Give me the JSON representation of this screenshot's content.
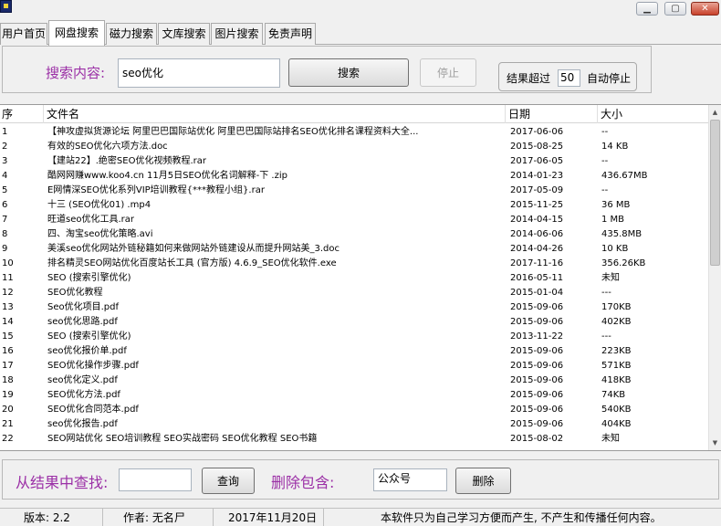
{
  "tabs": [
    {
      "label": "用户首页"
    },
    {
      "label": "网盘搜索"
    },
    {
      "label": "磁力搜索"
    },
    {
      "label": "文库搜索"
    },
    {
      "label": "图片搜索"
    },
    {
      "label": "免责声明"
    }
  ],
  "active_tab": "网盘搜索",
  "search": {
    "label": "搜索内容:",
    "value": "seo优化",
    "search_button": "搜索",
    "stop_button": "停止",
    "limit_prefix": "结果超过",
    "limit_value": "50",
    "limit_suffix": "自动停止"
  },
  "table": {
    "columns": [
      "序",
      "文件名",
      "日期",
      "大小"
    ],
    "rows": [
      {
        "no": "1",
        "name": "【神攻虚拟货源论坛 阿里巴巴国际站优化 阿里巴巴国际站排名SEO优化排名课程资料大全...",
        "date": "2017-06-06",
        "size": "--"
      },
      {
        "no": "2",
        "name": "有效的SEO优化六项方法.doc",
        "date": "2015-08-25",
        "size": "14 KB"
      },
      {
        "no": "3",
        "name": "【建站22】.绝密SEO优化视频教程.rar",
        "date": "2017-06-05",
        "size": "--"
      },
      {
        "no": "4",
        "name": "酷网网赚www.koo4.cn 11月5日SEO优化名词解释-下 .zip",
        "date": "2014-01-23",
        "size": "436.67MB"
      },
      {
        "no": "5",
        "name": "E网情深SEO优化系列VIP培训教程{***教程小组}.rar",
        "date": "2017-05-09",
        "size": "--"
      },
      {
        "no": "6",
        "name": "十三 (SEO优化01) .mp4",
        "date": "2015-11-25",
        "size": "36 MB"
      },
      {
        "no": "7",
        "name": "旺道seo优化工具.rar",
        "date": "2014-04-15",
        "size": "1 MB"
      },
      {
        "no": "8",
        "name": "四、淘宝seo优化策略.avi",
        "date": "2014-06-06",
        "size": "435.8MB"
      },
      {
        "no": "9",
        "name": "美溪seo优化网站外链秘籍如何来做网站外链建设从而提升网站美_3.doc",
        "date": "2014-04-26",
        "size": "10 KB"
      },
      {
        "no": "10",
        "name": "排名精灵SEO网站优化百度站长工具 (官方版) 4.6.9_SEO优化软件.exe",
        "date": "2017-11-16",
        "size": "356.26KB"
      },
      {
        "no": "11",
        "name": "SEO (搜索引擎优化)",
        "date": "2016-05-11",
        "size": "未知"
      },
      {
        "no": "12",
        "name": "SEO优化教程",
        "date": "2015-01-04",
        "size": "---"
      },
      {
        "no": "13",
        "name": "Seo优化项目.pdf",
        "date": "2015-09-06",
        "size": "170KB"
      },
      {
        "no": "14",
        "name": "seo优化思路.pdf",
        "date": "2015-09-06",
        "size": "402KB"
      },
      {
        "no": "15",
        "name": "SEO (搜索引擎优化)",
        "date": "2013-11-22",
        "size": "---"
      },
      {
        "no": "16",
        "name": "seo优化报价单.pdf",
        "date": "2015-09-06",
        "size": "223KB"
      },
      {
        "no": "17",
        "name": "SEO优化操作步骤.pdf",
        "date": "2015-09-06",
        "size": "571KB"
      },
      {
        "no": "18",
        "name": "seo优化定义.pdf",
        "date": "2015-09-06",
        "size": "418KB"
      },
      {
        "no": "19",
        "name": "SEO优化方法.pdf",
        "date": "2015-09-06",
        "size": "74KB"
      },
      {
        "no": "20",
        "name": "SEO优化合同范本.pdf",
        "date": "2015-09-06",
        "size": "540KB"
      },
      {
        "no": "21",
        "name": "seo优化报告.pdf",
        "date": "2015-09-06",
        "size": "404KB"
      },
      {
        "no": "22",
        "name": "SEO网站优化 SEO培训教程 SEO实战密码 SEO优化教程 SEO书籍",
        "date": "2015-08-02",
        "size": "未知"
      }
    ]
  },
  "filter": {
    "find_label": "从结果中查找:",
    "find_value": "",
    "find_button": "查询",
    "delete_label": "删除包含:",
    "delete_value": "公众号",
    "delete_button": "删除"
  },
  "status": {
    "version": "版本: 2.2",
    "author": "作者: 无名尸",
    "date": "2017年11月20日",
    "notice": "本软件只为自己学习方便而产生, 不产生和传播任何内容。"
  },
  "icons": {
    "minimize": "minimize-icon",
    "maximize": "maximize-icon",
    "close": "close-icon"
  },
  "colors": {
    "label_purple": "#9b2fa6"
  }
}
